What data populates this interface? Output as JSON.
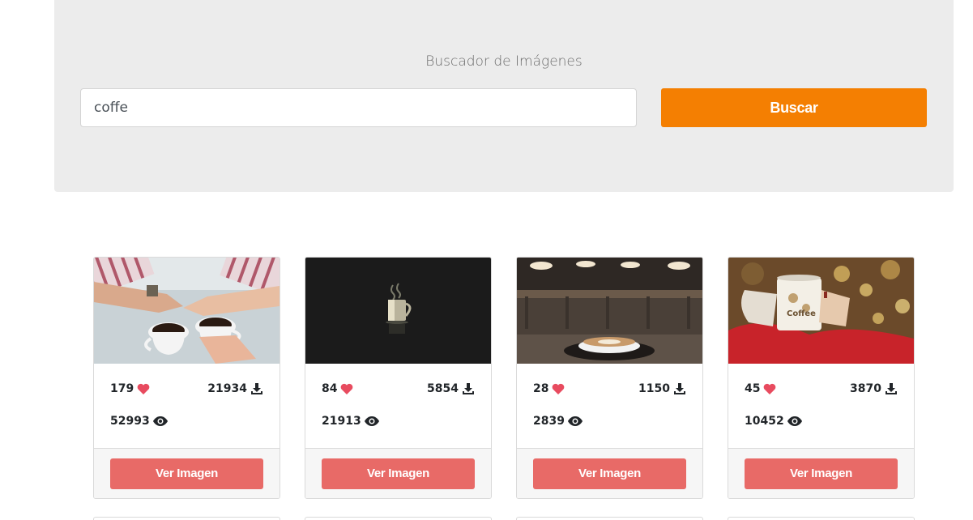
{
  "header": {
    "title": "Buscador de Imágenes",
    "search_value": "coffe",
    "search_button": "Buscar"
  },
  "results": [
    {
      "likes": "179",
      "downloads": "21934",
      "views": "52993",
      "button": "Ver Imagen",
      "image_subject": "two coffee cups with hands"
    },
    {
      "likes": "84",
      "downloads": "5854",
      "views": "21913",
      "button": "Ver Imagen",
      "image_subject": "steaming mug on black"
    },
    {
      "likes": "28",
      "downloads": "1150",
      "views": "2839",
      "button": "Ver Imagen",
      "image_subject": "latte art cup in cafe"
    },
    {
      "likes": "45",
      "downloads": "3870",
      "views": "10452",
      "button": "Ver Imagen",
      "image_subject": "hands holding coffee mug"
    }
  ],
  "icons": {
    "like": "heart-icon",
    "download": "download-icon",
    "views": "eye-icon"
  },
  "colors": {
    "accent_orange": "#f47f02",
    "button_red": "#e86a67",
    "heart": "#e84b5f",
    "panel_bg": "#ececec"
  }
}
